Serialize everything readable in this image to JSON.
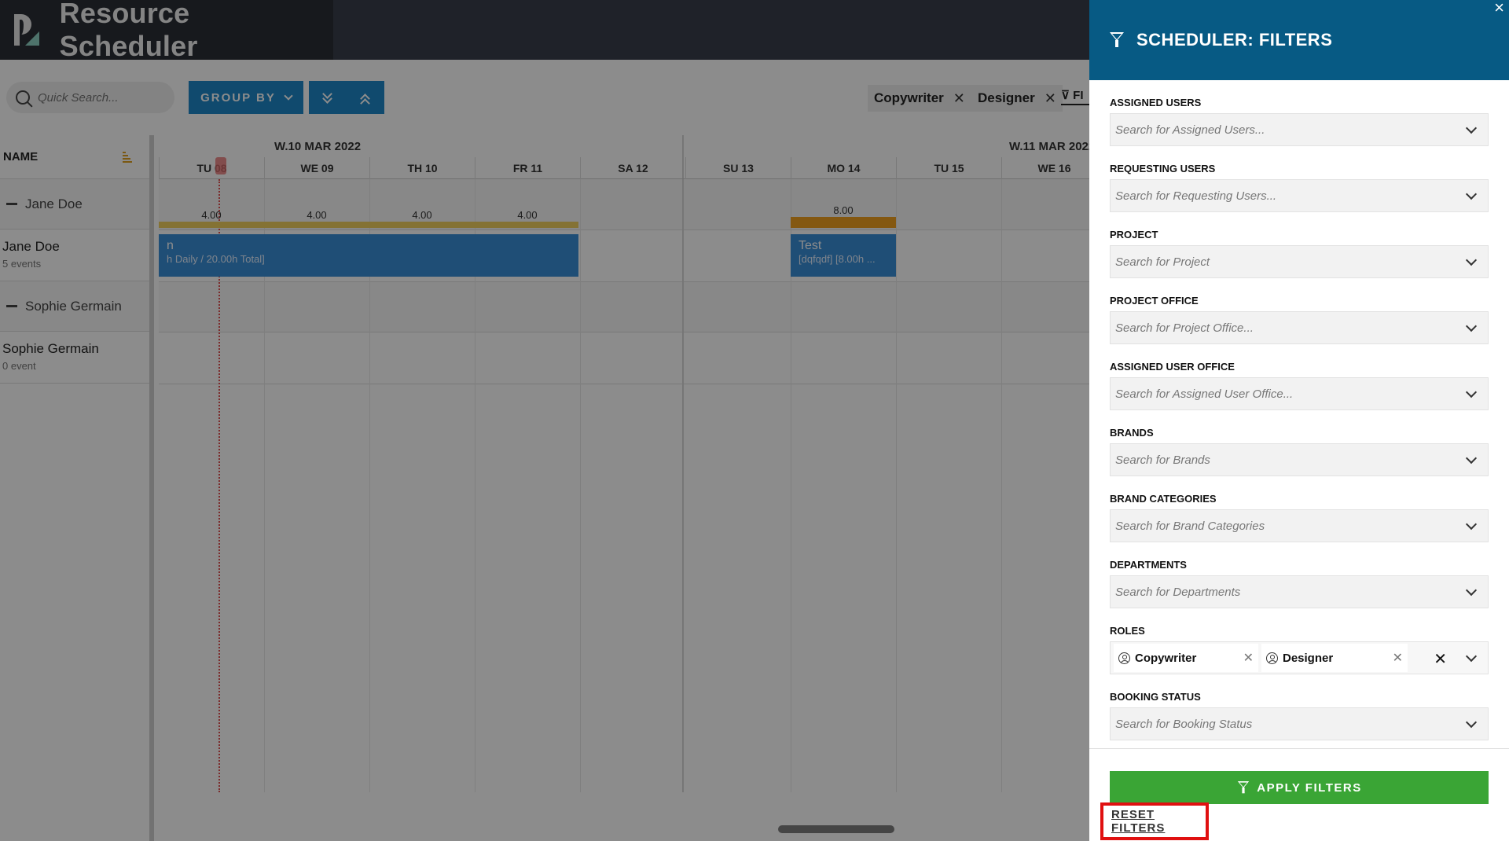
{
  "app": {
    "title": "Resource Scheduler"
  },
  "toolbar": {
    "search_placeholder": "Quick Search...",
    "group_by_label": "GROUP BY",
    "active_filters": [
      "Copywriter",
      "Designer"
    ],
    "filters_link": "FI"
  },
  "grid": {
    "name_header": "NAME",
    "weeks": [
      {
        "label": "W.10 MAR 2022"
      },
      {
        "label": "W.11 MAR 2022"
      }
    ],
    "days": [
      "TU 08",
      "WE 09",
      "TH 10",
      "FR 11",
      "SA 12",
      "SU 13",
      "MO 14",
      "TU 15",
      "WE 16"
    ],
    "rows": [
      {
        "type": "group",
        "label": "Jane Doe"
      },
      {
        "type": "person",
        "name": "Jane Doe",
        "events": "5 events"
      },
      {
        "type": "group",
        "label": "Sophie Germain"
      },
      {
        "type": "person",
        "name": "Sophie Germain",
        "events": "0 event"
      }
    ],
    "hours": [
      "4.00",
      "4.00",
      "4.00",
      "4.00",
      "8.00"
    ],
    "event_1_text": "h Daily / 20.00h Total]",
    "event_1_title": "n",
    "event_2_title": "Test",
    "event_2_text": "[dqfqdf] [8.00h ..."
  },
  "panel": {
    "title": "SCHEDULER: FILTERS",
    "close_label": "×",
    "fields": [
      {
        "label": "ASSIGNED USERS",
        "placeholder": "Search for Assigned Users..."
      },
      {
        "label": "REQUESTING USERS",
        "placeholder": "Search for Requesting Users..."
      },
      {
        "label": "PROJECT",
        "placeholder": "Search for Project"
      },
      {
        "label": "PROJECT OFFICE",
        "placeholder": "Search for Project Office..."
      },
      {
        "label": "ASSIGNED USER OFFICE",
        "placeholder": "Search for Assigned User Office..."
      },
      {
        "label": "BRANDS",
        "placeholder": "Search for Brands"
      },
      {
        "label": "BRAND CATEGORIES",
        "placeholder": "Search for Brand Categories"
      },
      {
        "label": "DEPARTMENTS",
        "placeholder": "Search for Departments"
      }
    ],
    "roles": {
      "label": "ROLES",
      "selected": [
        "Copywriter",
        "Designer"
      ]
    },
    "booking_status": {
      "label": "BOOKING STATUS",
      "placeholder": "Search for Booking Status"
    },
    "apply_label": "APPLY FILTERS",
    "reset_label": "RESET FILTERS"
  }
}
